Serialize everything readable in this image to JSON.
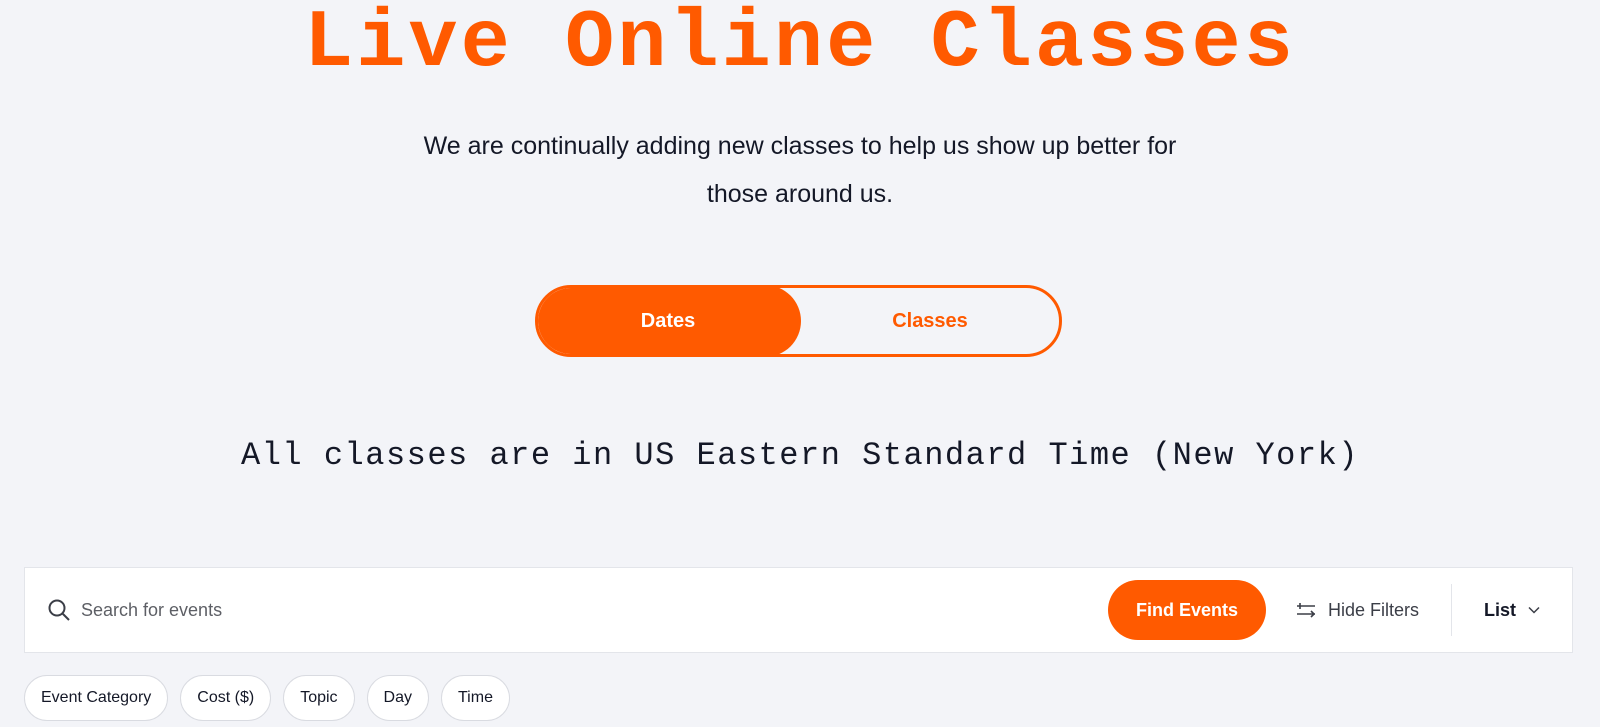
{
  "hero": {
    "title": "Live Online Classes",
    "subtitle_line1": "We are continually adding new classes to help us show up better for",
    "subtitle_line2": "those around us."
  },
  "toggle": {
    "options": [
      {
        "label": "Dates",
        "active": true
      },
      {
        "label": "Classes",
        "active": false
      }
    ]
  },
  "timezone_note": "All classes are in US Eastern Standard Time (New York)",
  "search_bar": {
    "icon": "search-icon",
    "placeholder": "Search for events",
    "value": "",
    "find_button_label": "Find Events",
    "hide_filters_icon": "sliders-icon",
    "hide_filters_label": "Hide Filters",
    "view_selected": "List",
    "view_icon": "chevron-down-icon"
  },
  "filters": [
    "Event Category",
    "Cost ($)",
    "Topic",
    "Day",
    "Time"
  ],
  "colors": {
    "accent": "#ff5a00",
    "background": "#f3f4f8",
    "text": "#141827"
  }
}
